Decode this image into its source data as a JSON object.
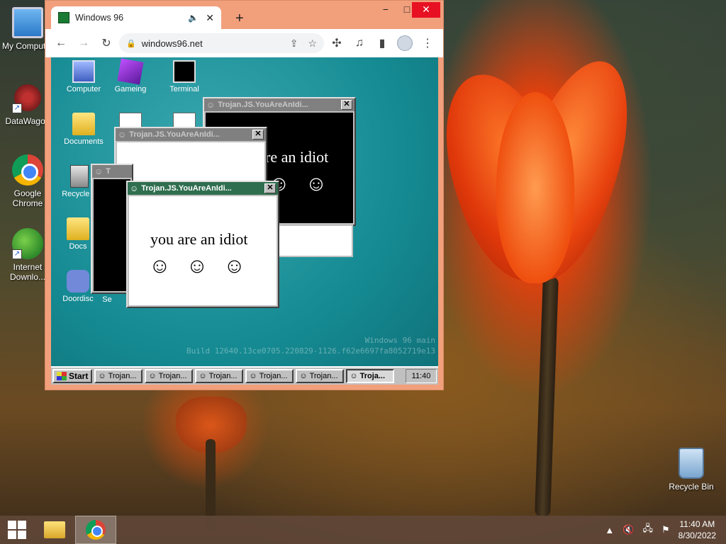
{
  "desktop": {
    "icons": [
      {
        "label": "My Computer",
        "icon": "monitor-icon"
      },
      {
        "label": "DataWagon",
        "icon": "virus-icon"
      },
      {
        "label": "Google Chrome",
        "icon": "chrome-icon"
      },
      {
        "label": "Internet Downlo...",
        "icon": "idm-icon"
      },
      {
        "label": "Recycle Bin",
        "icon": "recycle-bin-icon"
      }
    ]
  },
  "chrome": {
    "tab_title": "Windows 96",
    "new_tab": "+",
    "url": "windows96.net",
    "window_controls": {
      "minimize": "−",
      "maximize": "□",
      "close": "✕"
    }
  },
  "w96": {
    "icons": [
      {
        "label": "Computer"
      },
      {
        "label": "Gameing"
      },
      {
        "label": "Terminal"
      },
      {
        "label": "Documents"
      },
      {
        "label": "Recycle B"
      },
      {
        "label": "Docs"
      },
      {
        "label": "Doordisc"
      },
      {
        "label": "Se"
      }
    ],
    "windows": [
      {
        "title": "Trojan.JS.YouAreAnIdi...",
        "text": "re an idiot",
        "smileys": "☺☺"
      },
      {
        "title": "Trojan.JS.YouAreAnIdi...",
        "text": "",
        "smileys": ""
      },
      {
        "title": "T",
        "text": "",
        "smileys": ""
      },
      {
        "title": "Trojan.JS.YouAreAnIdi...",
        "text": "you are an idiot",
        "smileys": "☺☺☺"
      }
    ],
    "watermark_line1": "Windows 96 main",
    "watermark_line2": "Build 12640.13ce0705.220829-1126.f62e6697fa8052719e13",
    "taskbar": {
      "start_label": "Start",
      "tasks": [
        "Trojan...",
        "Trojan...",
        "Trojan...",
        "Trojan...",
        "Trojan...",
        "Troja..."
      ],
      "clock": "11:40"
    }
  },
  "host_taskbar": {
    "time": "11:40 AM",
    "date": "8/30/2022",
    "tray_up": "▲"
  }
}
